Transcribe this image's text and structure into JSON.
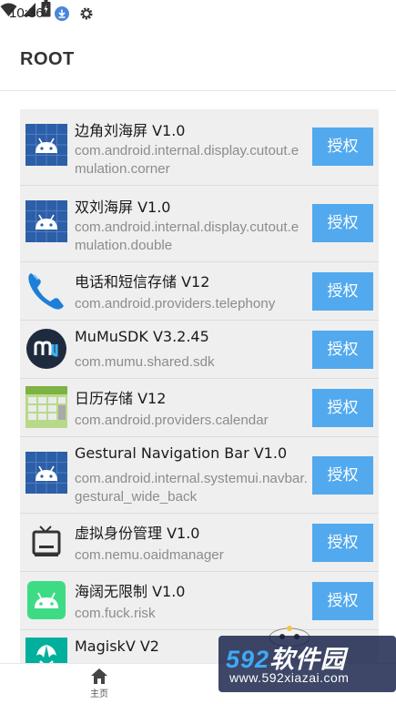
{
  "status_bar": {
    "time": "10:36",
    "icons": [
      "download-icon",
      "settings-icon",
      "wifi-icon",
      "signal-icon",
      "battery-icon"
    ]
  },
  "app_bar": {
    "title": "ROOT"
  },
  "apps": [
    {
      "name": "边角刘海屏  V1.0",
      "package": "com.android.internal.display.cutout.emulation.corner",
      "icon": "android-grid-icon",
      "button": "授权"
    },
    {
      "name": "双刘海屏  V1.0",
      "package": "com.android.internal.display.cutout.emulation.double",
      "icon": "android-grid-icon",
      "button": "授权"
    },
    {
      "name": "电话和短信存储  V12",
      "package": "com.android.providers.telephony",
      "icon": "phone-icon",
      "button": "授权"
    },
    {
      "name": "MuMuSDK  V3.2.45",
      "package": "com.mumu.shared.sdk",
      "icon": "mumu-icon",
      "button": "授权"
    },
    {
      "name": "日历存储  V12",
      "package": "com.android.providers.calendar",
      "icon": "calendar-icon",
      "button": "授权"
    },
    {
      "name": "Gestural Navigation Bar  V1.0",
      "package": "com.android.internal.systemui.navbar.gestural_wide_back",
      "icon": "android-grid-icon",
      "button": "授权"
    },
    {
      "name": "虚拟身份管理  V1.0",
      "package": "com.nemu.oaidmanager",
      "icon": "tv-icon",
      "button": "授权"
    },
    {
      "name": "海阔无限制  V1.0",
      "package": "com.fuck.risk",
      "icon": "android-green-icon",
      "button": "授权"
    },
    {
      "name": "MagiskV  V2",
      "package": "",
      "icon": "magisk-icon",
      "button": ""
    }
  ],
  "bottom_nav": {
    "home_label": "主页"
  },
  "watermark": {
    "brand_num": "592",
    "brand_text": "软件园",
    "url": "www.592xiazai.com"
  },
  "colors": {
    "accent": "#52a9ee",
    "list_bg": "#efefef",
    "icon_blue": "#2c5fa8"
  }
}
